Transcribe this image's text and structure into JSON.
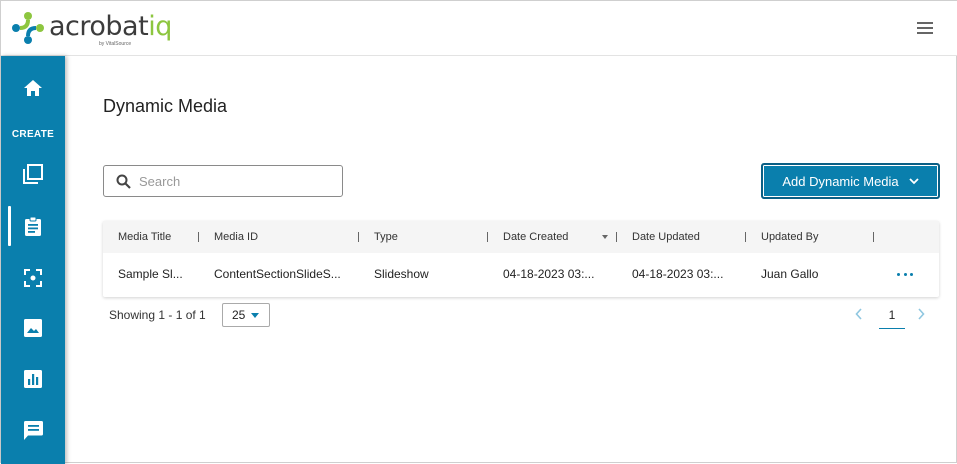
{
  "brand": {
    "name_part1": "acrobat",
    "name_part2": "iq",
    "tagline": "by VitalSource",
    "green": "#8dc63f",
    "blue": "#0a7fad"
  },
  "header": {
    "menu_icon": "hamburger-icon"
  },
  "sidebar": {
    "create_label": "CREATE",
    "items": [
      {
        "icon": "home-icon"
      },
      {
        "icon": "copy-icon"
      },
      {
        "icon": "clipboard-icon",
        "active": true
      },
      {
        "icon": "focus-icon"
      },
      {
        "icon": "image-icon"
      },
      {
        "icon": "chart-icon"
      },
      {
        "icon": "comment-icon"
      }
    ]
  },
  "page": {
    "title": "Dynamic Media"
  },
  "search": {
    "placeholder": "Search",
    "value": ""
  },
  "toolbar": {
    "add_label": "Add Dynamic Media"
  },
  "table": {
    "columns": [
      "Media Title",
      "Media ID",
      "Type",
      "Date Created",
      "Date Updated",
      "Updated By"
    ],
    "rows": [
      [
        "Sample Sl...",
        "ContentSectionSlideS...",
        "Slideshow",
        "04-18-2023 03:...",
        "04-18-2023 03:...",
        "Juan Gallo"
      ]
    ]
  },
  "footer": {
    "showing": "Showing 1 - 1 of 1",
    "per_page": "25",
    "current_page": "1"
  }
}
